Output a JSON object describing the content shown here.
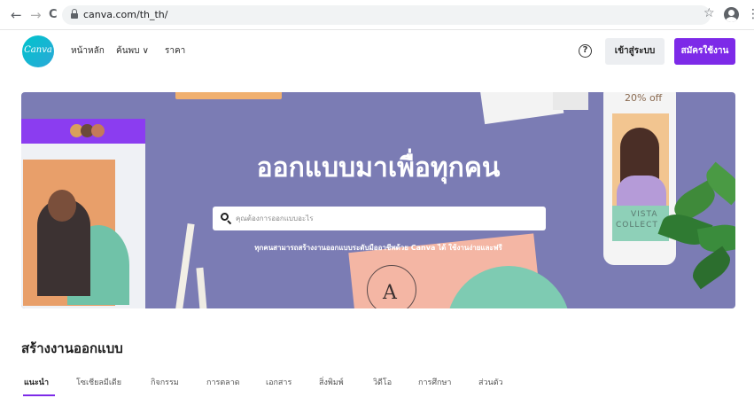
{
  "browser": {
    "url": "canva.com/th_th/",
    "back_glyph": "←",
    "forward_glyph": "→",
    "reload_glyph": "C",
    "star_glyph": "☆",
    "menu_glyph": "⋮"
  },
  "header": {
    "logo_text": "Canva",
    "nav": [
      "หน้าหลัก",
      "ค้นพบ ∨",
      "ราคา"
    ],
    "help_glyph": "?",
    "login_label": "เข้าสู่ระบบ",
    "signup_label": "สมัครใช้งาน"
  },
  "hero": {
    "title": "ออกแบบมาเพื่อทุกคน",
    "search_placeholder": "คุณต้องการออกแบบอะไร",
    "subtitle": "ทุกคนสามารถสร้างงานออกแบบระดับมืออาชีพด้วย Canva ได้ ใช้งานง่ายและฟรี",
    "promo_text": "20% off",
    "card_text": [
      "VISTA",
      "COLLECT"
    ],
    "letter": "A"
  },
  "section": {
    "title": "สร้างงานออกแบบ",
    "tabs": [
      "แนะนำ",
      "โซเชียลมีเดีย",
      "กิจกรรม",
      "การตลาด",
      "เอกสาร",
      "สิ่งพิมพ์",
      "วิดีโอ",
      "การศึกษา",
      "ส่วนตัว"
    ]
  },
  "colors": {
    "brand_purple": "#7d2ae8",
    "hero_bg": "#7b7cb4",
    "logo_teal": "#00c4cc"
  }
}
